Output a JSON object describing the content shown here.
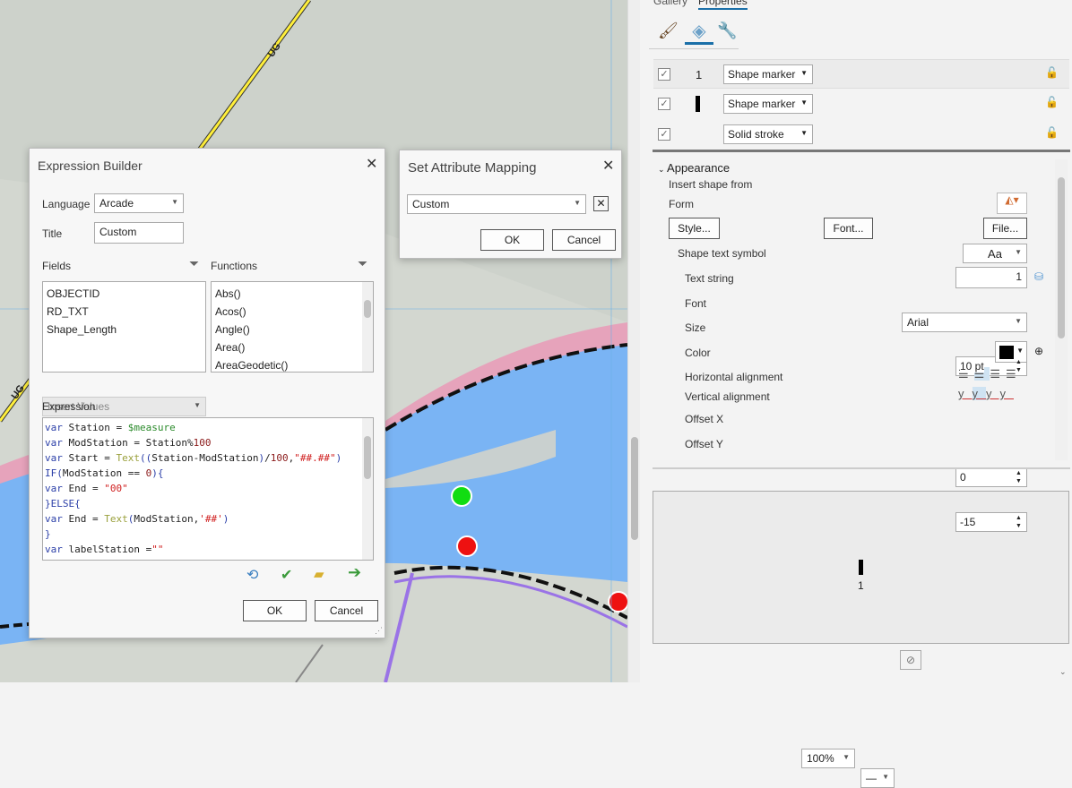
{
  "map": {
    "road_label": "UG",
    "colors": {
      "water": "#7bb4f5",
      "pink": "#e8a0b8",
      "purple": "#9a73e6",
      "green_point": "#11dd11",
      "red_point": "#ee1111"
    }
  },
  "expression_builder": {
    "title": "Expression Builder",
    "language_label": "Language",
    "language_value": "Arcade",
    "title_label": "Title",
    "title_value": "Custom",
    "fields_label": "Fields",
    "functions_label": "Functions",
    "fields": [
      "OBJECTID",
      "RD_TXT",
      "Shape_Length"
    ],
    "functions": [
      "Abs()",
      "Acos()",
      "Angle()",
      "Area()",
      "AreaGeodetic()"
    ],
    "insert_values": "Insert Values",
    "expression_label": "Expression",
    "code": [
      "var Station = $measure",
      "var ModStation = Station%100",
      "var Start = Text((Station-ModStation)/100,\"##.##\")",
      "IF(ModStation == 0){",
      "var End = \"00\"",
      "}ELSE{",
      "var End = Text(ModStation,'##')",
      "}",
      "var labelStation =\"\""
    ],
    "ok": "OK",
    "cancel": "Cancel"
  },
  "attribute_mapping": {
    "title": "Set Attribute Mapping",
    "value": "Custom",
    "ok": "OK",
    "cancel": "Cancel"
  },
  "panel": {
    "tabs": [
      "Gallery",
      "Properties"
    ],
    "layers": [
      {
        "preview": "1",
        "type": "Shape marker"
      },
      {
        "preview": "",
        "type": "Shape marker"
      },
      {
        "preview": "",
        "type": "Solid stroke"
      }
    ],
    "appearance": {
      "header": "Appearance",
      "insert_shape": "Insert shape from",
      "form": "Form",
      "style_btn": "Style...",
      "font_btn": "Font...",
      "file_btn": "File...",
      "shape_text_symbol": "Shape text symbol",
      "symbol_value": "Aa",
      "text_string_label": "Text string",
      "text_string": "1",
      "font_label": "Font",
      "font": "Arial",
      "size_label": "Size",
      "size": "10 pt",
      "color_label": "Color",
      "color": "#000000",
      "halign_label": "Horizontal alignment",
      "valign_label": "Vertical alignment",
      "offset_x_label": "Offset X",
      "offset_x": "0",
      "offset_y_label": "Offset Y",
      "offset_y": "-15"
    },
    "preview_label": "1",
    "zoom": "100%"
  }
}
